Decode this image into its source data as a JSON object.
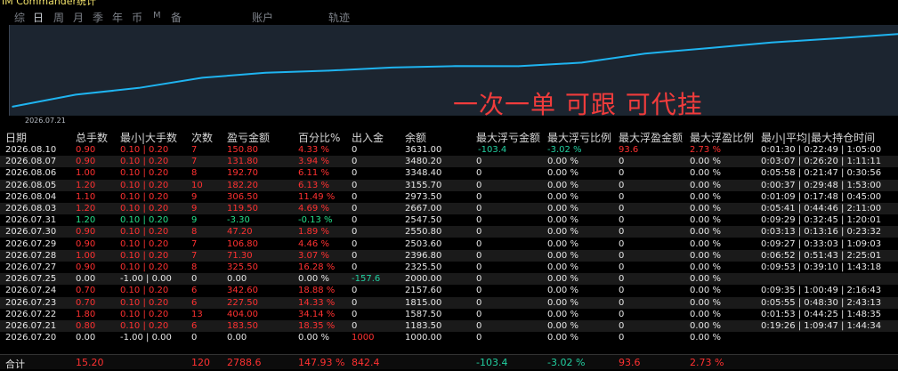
{
  "app": {
    "title": "IM Commander统计"
  },
  "tabs": [
    "综",
    "日",
    "周",
    "月",
    "季",
    "年",
    "币",
    "M",
    "备",
    "账户",
    "轨迹"
  ],
  "active_tab": "日",
  "chart": {
    "start_label": "2026.07.21",
    "promo_text": "一次一单  可跟  可代挂",
    "line_color": "#1fb4f0",
    "background": "#1c2530"
  },
  "chart_data": {
    "type": "line",
    "x": [
      "2026.07.21",
      "2026.07.22",
      "2026.07.23",
      "2026.07.24",
      "2026.07.27",
      "2026.07.28",
      "2026.07.29",
      "2026.07.30",
      "2026.07.31",
      "2026.08.03",
      "2026.08.04",
      "2026.08.05",
      "2026.08.06",
      "2026.08.07",
      "2026.08.10"
    ],
    "values": [
      1183.5,
      1587.5,
      1815.0,
      2157.6,
      2325.5,
      2396.8,
      2503.6,
      2550.8,
      2547.5,
      2667.0,
      2973.5,
      3155.7,
      3348.4,
      3480.2,
      3631.0
    ],
    "ylim": [
      1000,
      3700
    ]
  },
  "columns": [
    "日期",
    "总手数",
    "最小|大手数",
    "次数",
    "盈亏金额",
    "百分比%",
    "出入金",
    "余额",
    "最大浮亏金额",
    "最大浮亏比例",
    "最大浮盈金额",
    "最大浮盈比例",
    "最小|平均|最大持仓时间"
  ],
  "rows": [
    {
      "date": "2026.08.10",
      "lots": "0.90",
      "minmax": "0.10 | 0.20",
      "count": "7",
      "pnl": "150.80",
      "pct": "4.33 %",
      "io": "0",
      "bal": "3631.00",
      "mfl": "-103.4",
      "mflp": "-3.02 %",
      "mfp": "93.6",
      "mfpp": "2.73 %",
      "time": "0:01:30 | 0:22:49 | 1:05:00",
      "color": "red"
    },
    {
      "date": "2026.08.07",
      "lots": "0.90",
      "minmax": "0.10 | 0.20",
      "count": "7",
      "pnl": "131.80",
      "pct": "3.94 %",
      "io": "0",
      "bal": "3480.20",
      "mfl": "0",
      "mflp": "0.00 %",
      "mfp": "0",
      "mfpp": "0.00 %",
      "time": "0:03:07 | 0:26:20 | 1:11:11",
      "color": "red"
    },
    {
      "date": "2026.08.06",
      "lots": "1.00",
      "minmax": "0.10 | 0.20",
      "count": "8",
      "pnl": "192.70",
      "pct": "6.11 %",
      "io": "0",
      "bal": "3348.40",
      "mfl": "0",
      "mflp": "0.00 %",
      "mfp": "0",
      "mfpp": "0.00 %",
      "time": "0:05:58 | 0:21:47 | 0:30:56",
      "color": "red"
    },
    {
      "date": "2026.08.05",
      "lots": "1.20",
      "minmax": "0.10 | 0.20",
      "count": "10",
      "pnl": "182.20",
      "pct": "6.13 %",
      "io": "0",
      "bal": "3155.70",
      "mfl": "0",
      "mflp": "0.00 %",
      "mfp": "0",
      "mfpp": "0.00 %",
      "time": "0:00:37 | 0:29:48 | 1:53:00",
      "color": "red"
    },
    {
      "date": "2026.08.04",
      "lots": "1.10",
      "minmax": "0.10 | 0.20",
      "count": "9",
      "pnl": "306.50",
      "pct": "11.49 %",
      "io": "0",
      "bal": "2973.50",
      "mfl": "0",
      "mflp": "0.00 %",
      "mfp": "0",
      "mfpp": "0.00 %",
      "time": "0:01:09 | 0:17:48 | 0:45:00",
      "color": "red"
    },
    {
      "date": "2026.08.03",
      "lots": "1.20",
      "minmax": "0.10 | 0.20",
      "count": "9",
      "pnl": "119.50",
      "pct": "4.69 %",
      "io": "0",
      "bal": "2667.00",
      "mfl": "0",
      "mflp": "0.00 %",
      "mfp": "0",
      "mfpp": "0.00 %",
      "time": "0:05:41 | 0:44:46 | 2:11:00",
      "color": "red"
    },
    {
      "date": "2026.07.31",
      "lots": "1.20",
      "minmax": "0.10 | 0.20",
      "count": "9",
      "pnl": "-3.30",
      "pct": "-0.13 %",
      "io": "0",
      "bal": "2547.50",
      "mfl": "0",
      "mflp": "0.00 %",
      "mfp": "0",
      "mfpp": "0.00 %",
      "time": "0:09:29 | 0:32:45 | 1:20:01",
      "color": "green"
    },
    {
      "date": "2026.07.30",
      "lots": "0.90",
      "minmax": "0.10 | 0.20",
      "count": "8",
      "pnl": "47.20",
      "pct": "1.89 %",
      "io": "0",
      "bal": "2550.80",
      "mfl": "0",
      "mflp": "0.00 %",
      "mfp": "0",
      "mfpp": "0.00 %",
      "time": "0:03:13 | 0:13:16 | 0:23:32",
      "color": "red"
    },
    {
      "date": "2026.07.29",
      "lots": "0.90",
      "minmax": "0.10 | 0.20",
      "count": "7",
      "pnl": "106.80",
      "pct": "4.46 %",
      "io": "0",
      "bal": "2503.60",
      "mfl": "0",
      "mflp": "0.00 %",
      "mfp": "0",
      "mfpp": "0.00 %",
      "time": "0:09:27 | 0:33:03 | 1:09:03",
      "color": "red"
    },
    {
      "date": "2026.07.28",
      "lots": "1.00",
      "minmax": "0.10 | 0.20",
      "count": "7",
      "pnl": "71.30",
      "pct": "3.07 %",
      "io": "0",
      "bal": "2396.80",
      "mfl": "0",
      "mflp": "0.00 %",
      "mfp": "0",
      "mfpp": "0.00 %",
      "time": "0:06:52 | 0:51:43 | 2:25:01",
      "color": "red"
    },
    {
      "date": "2026.07.27",
      "lots": "0.90",
      "minmax": "0.10 | 0.20",
      "count": "8",
      "pnl": "325.50",
      "pct": "16.28 %",
      "io": "0",
      "bal": "2325.50",
      "mfl": "0",
      "mflp": "0.00 %",
      "mfp": "0",
      "mfpp": "0.00 %",
      "time": "0:09:53 | 0:39:10 | 1:43:18",
      "color": "red"
    },
    {
      "date": "2026.07.25",
      "lots": "0.00",
      "minmax": "-1.00 | 0.00",
      "count": "0",
      "pnl": "0.00",
      "pct": "0.00 %",
      "io": "-157.6",
      "bal": "2000.00",
      "mfl": "0",
      "mflp": "0.00 %",
      "mfp": "0",
      "mfpp": "0.00 %",
      "time": "",
      "color": "white"
    },
    {
      "date": "2026.07.24",
      "lots": "0.70",
      "minmax": "0.10 | 0.20",
      "count": "6",
      "pnl": "342.60",
      "pct": "18.88 %",
      "io": "0",
      "bal": "2157.60",
      "mfl": "0",
      "mflp": "0.00 %",
      "mfp": "0",
      "mfpp": "0.00 %",
      "time": "0:09:35 | 1:00:49 | 2:16:43",
      "color": "red"
    },
    {
      "date": "2026.07.23",
      "lots": "0.70",
      "minmax": "0.10 | 0.20",
      "count": "6",
      "pnl": "227.50",
      "pct": "14.33 %",
      "io": "0",
      "bal": "1815.00",
      "mfl": "0",
      "mflp": "0.00 %",
      "mfp": "0",
      "mfpp": "0.00 %",
      "time": "0:05:55 | 0:48:30 | 2:43:13",
      "color": "red"
    },
    {
      "date": "2026.07.22",
      "lots": "1.80",
      "minmax": "0.10 | 0.20",
      "count": "13",
      "pnl": "404.00",
      "pct": "34.14 %",
      "io": "0",
      "bal": "1587.50",
      "mfl": "0",
      "mflp": "0.00 %",
      "mfp": "0",
      "mfpp": "0.00 %",
      "time": "0:01:53 | 0:44:25 | 1:48:35",
      "color": "red"
    },
    {
      "date": "2026.07.21",
      "lots": "0.80",
      "minmax": "0.10 | 0.20",
      "count": "6",
      "pnl": "183.50",
      "pct": "18.35 %",
      "io": "0",
      "bal": "1183.50",
      "mfl": "0",
      "mflp": "0.00 %",
      "mfp": "0",
      "mfpp": "0.00 %",
      "time": "0:19:26 | 1:09:47 | 1:44:34",
      "color": "red"
    },
    {
      "date": "2026.07.20",
      "lots": "0.00",
      "minmax": "-1.00 | 0.00",
      "count": "0",
      "pnl": "0.00",
      "pct": "0.00 %",
      "io": "1000",
      "bal": "1000.00",
      "mfl": "0",
      "mflp": "0.00 %",
      "mfp": "0",
      "mfpp": "0.00 %",
      "time": "",
      "color": "white"
    }
  ],
  "totals": {
    "label": "合计",
    "lots": "15.20",
    "count": "120",
    "pnl": "2788.6",
    "pct": "147.93 %",
    "io": "842.4",
    "mfl": "-103.4",
    "mflp": "-3.02 %",
    "mfp": "93.6",
    "mfpp": "2.73 %"
  }
}
